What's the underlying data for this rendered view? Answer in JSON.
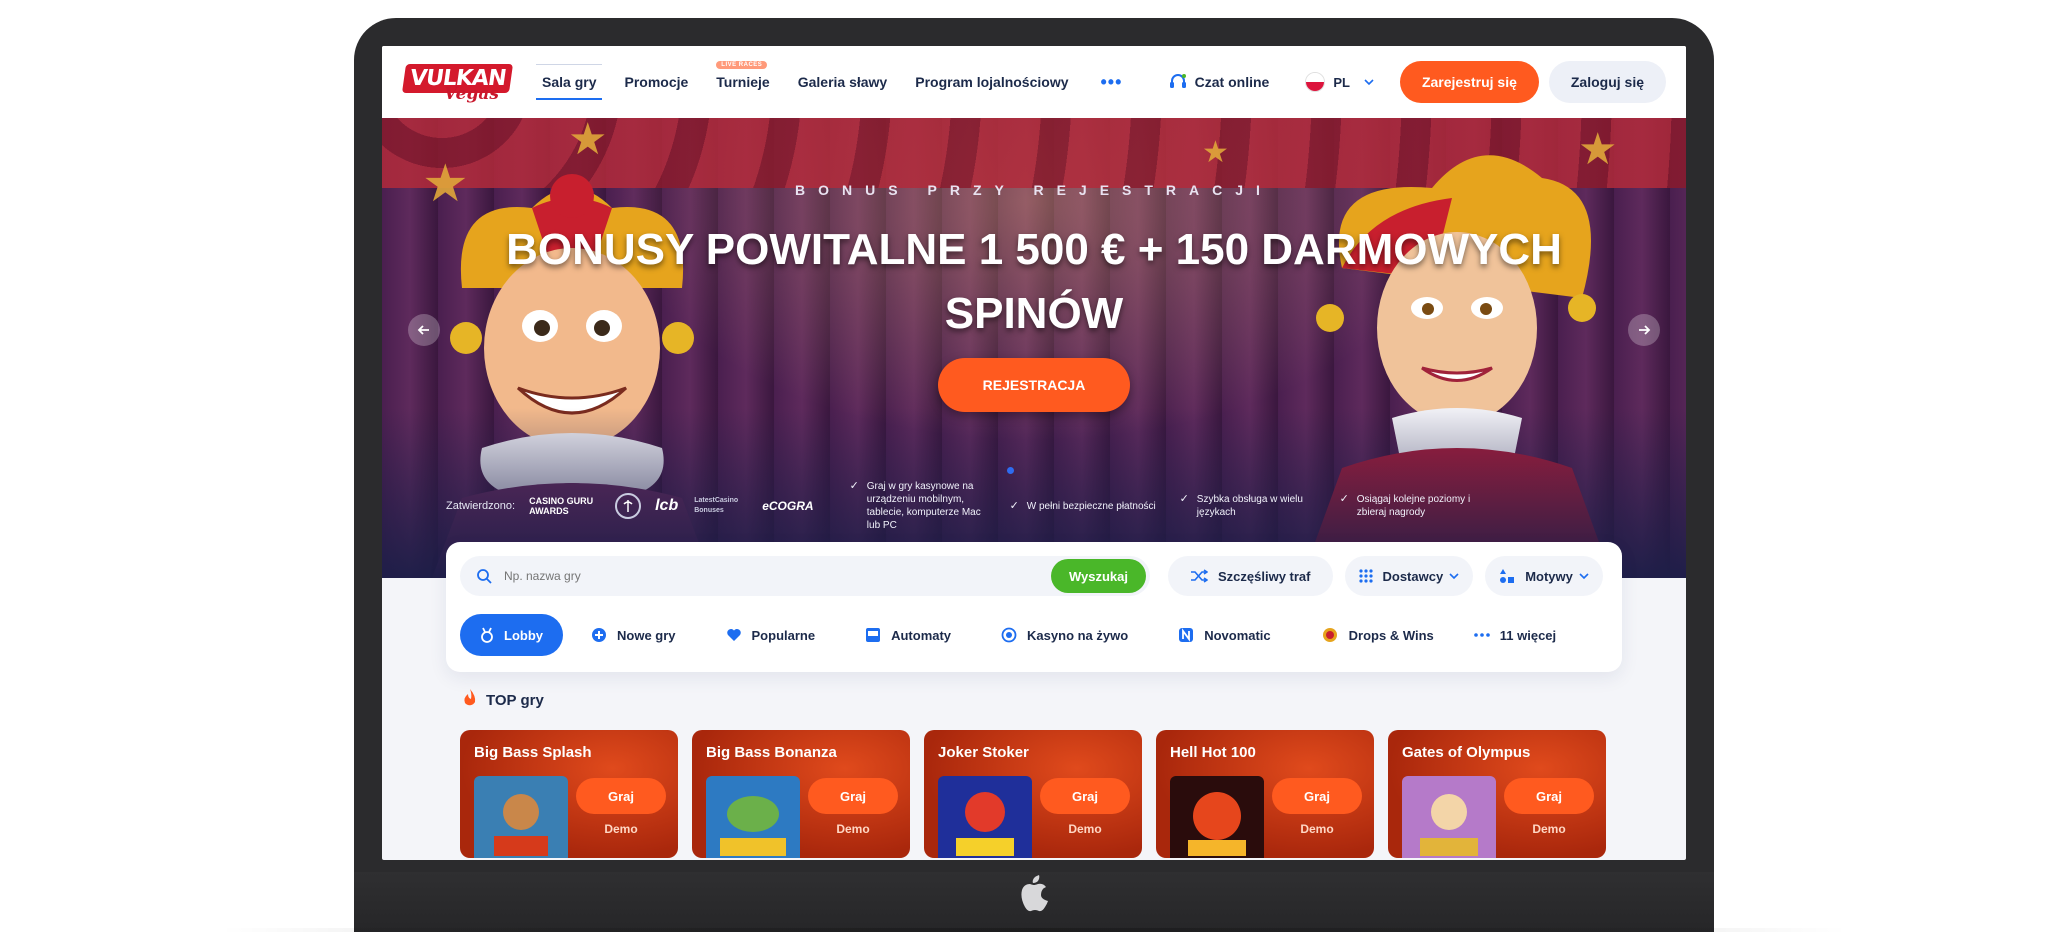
{
  "brand": {
    "logo_main": "VULKAN",
    "logo_sub": "Vegas"
  },
  "nav": {
    "items": [
      {
        "label": "Sala gry",
        "active": true
      },
      {
        "label": "Promocje"
      },
      {
        "label": "Turnieje",
        "badge": "LIVE RACES"
      },
      {
        "label": "Galeria sławy"
      },
      {
        "label": "Program lojalnościowy"
      }
    ],
    "more": "•••"
  },
  "header": {
    "chat_label": "Czat online",
    "lang_code": "PL",
    "register_label": "Zarejestruj się",
    "login_label": "Zaloguj się"
  },
  "hero": {
    "kicker": "BONUS PRZY REJESTRACJI",
    "title": "BONUSY POWITALNE 1 500 € + 150 DARMOWYCH SPINÓW",
    "cta": "REJESTRACJA"
  },
  "trust": {
    "label": "Zatwierdzono:",
    "logos": [
      "CASINO GURU AWARDS",
      "lcb",
      "LatestCasino Bonuses",
      "eCOGRA"
    ],
    "features": [
      "Graj w gry kasynowe na urządzeniu mobilnym, tablecie, komputerze Mac lub PC",
      "W pełni bezpieczne płatności",
      "Szybka obsługa w wielu językach",
      "Osiągaj kolejne poziomy i zbieraj nagrody"
    ]
  },
  "search": {
    "placeholder": "Np. nazwa gry",
    "button": "Wyszukaj",
    "lucky": "Szczęśliwy traf",
    "providers": "Dostawcy",
    "themes": "Motywy"
  },
  "categories": [
    {
      "label": "Lobby",
      "icon": "medal-icon"
    },
    {
      "label": "Nowe gry",
      "icon": "plus-circle-icon"
    },
    {
      "label": "Popularne",
      "icon": "heart-icon"
    },
    {
      "label": "Automaty",
      "icon": "slot-machine-icon"
    },
    {
      "label": "Kasyno na żywo",
      "icon": "live-icon"
    },
    {
      "label": "Novomatic",
      "icon": "novomatic-icon"
    },
    {
      "label": "Drops & Wins",
      "icon": "drops-wins-icon"
    },
    {
      "label": "11 więcej",
      "icon": "dots-icon"
    }
  ],
  "top_games": {
    "title": "TOP gry",
    "play_label": "Graj",
    "demo_label": "Demo",
    "games": [
      {
        "title": "Big Bass Splash"
      },
      {
        "title": "Big Bass Bonanza"
      },
      {
        "title": "Joker Stoker"
      },
      {
        "title": "Hell Hot 100"
      },
      {
        "title": "Gates of Olympus"
      }
    ]
  },
  "colors": {
    "accent": "#ff5a1f",
    "primary": "#1d6df0",
    "success": "#4ab729",
    "text": "#1c2a4a"
  }
}
